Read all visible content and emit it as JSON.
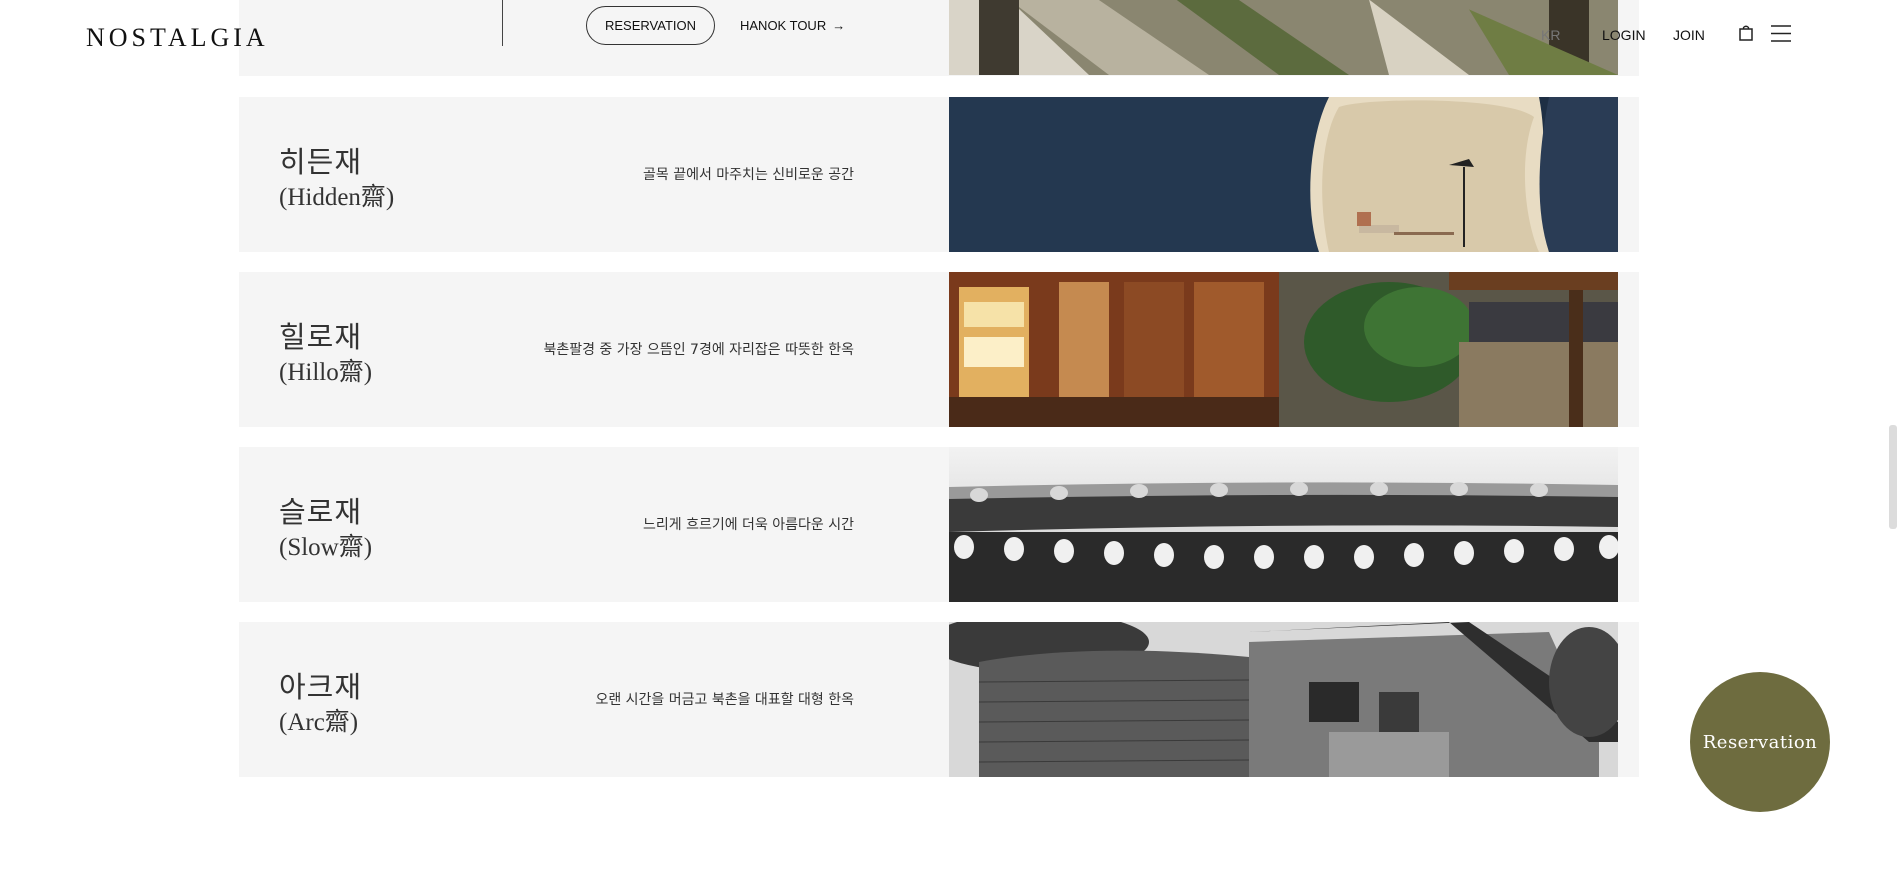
{
  "header": {
    "logo": "NOSTALGIA",
    "reservation_button": "RESERVATION",
    "tour_link": "HANOK TOUR",
    "tour_arrow": "→",
    "lang": "KR",
    "login": "LOGIN",
    "join": "JOIN",
    "cart_icon": "shopping-bag-icon",
    "menu_icon": "hamburger-menu-icon"
  },
  "stays": [
    {
      "name_ko": "히든재",
      "name_en": "(Hidden齋)",
      "description": "골목 끝에서 마주치는 신비로운 공간",
      "photo": "hidden-interior"
    },
    {
      "name_ko": "힐로재",
      "name_en": "(Hillo齋)",
      "description": "북촌팔경 중 가장 으뜸인 7경에 자리잡은 따뜻한 한옥",
      "photo": "hillo-courtyard"
    },
    {
      "name_ko": "슬로재",
      "name_en": "(Slow齋)",
      "description": "느리게 흐르기에 더욱 아름다운 시간",
      "photo": "slow-eaves"
    },
    {
      "name_ko": "아크재",
      "name_en": "(Arc齋)",
      "description": "오랜 시간을 머금고 북촌을 대표할 대형 한옥",
      "photo": "arc-building"
    }
  ],
  "floating": {
    "reservation": "Reservation"
  },
  "colors": {
    "accent": "#6e6c3f",
    "card_bg": "#f5f5f5"
  }
}
